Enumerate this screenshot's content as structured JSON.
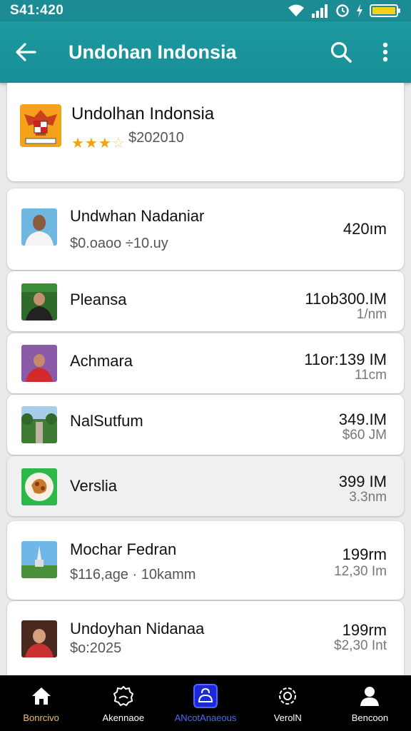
{
  "status_bar": {
    "time": "S41:420"
  },
  "app_bar": {
    "title": "Undohan Indonsia"
  },
  "header_card": {
    "title": "Undolhan Indonsia",
    "rating": 3,
    "rating_max": 5,
    "price": "$202010"
  },
  "rows": [
    {
      "name": "Undwhan Nadaniar",
      "sub": "$0.oaoo ÷10.uy",
      "main": "420ım",
      "sec": ""
    },
    {
      "name": "Pleansa",
      "sub": "",
      "main": "11ob300.IM",
      "sec": "1/nm"
    },
    {
      "name": "Achmara",
      "sub": "",
      "main": "11or:139 IM",
      "sec": "11cm"
    },
    {
      "name": "NalSutfum",
      "sub": "",
      "main": "349.IM",
      "sec": "$60 JM"
    },
    {
      "name": "Verslia",
      "sub": "",
      "main": "399 IM",
      "sec": "3.3nm"
    },
    {
      "name": "Mochar Fedran",
      "sub": "$116,age · 10kamm",
      "main": "199rm",
      "sec": "12,30 Im"
    },
    {
      "name": "Undoyhan Nidanaa",
      "sub": "$o:2025",
      "main": "199rm",
      "sec": "$2,30 Int"
    }
  ],
  "bottom_nav": [
    {
      "label": "Bonrcivo",
      "icon": "home-icon"
    },
    {
      "label": "Akennaoe",
      "icon": "badge-icon"
    },
    {
      "label": "ANcotAnaeous",
      "icon": "bag-icon"
    },
    {
      "label": "VerolN",
      "icon": "gear-icon"
    },
    {
      "label": "Bencoon",
      "icon": "profile-icon"
    }
  ],
  "colors": {
    "primary": "#1b8c93",
    "accent": "#4a6bff",
    "star": "#f2a20f"
  }
}
